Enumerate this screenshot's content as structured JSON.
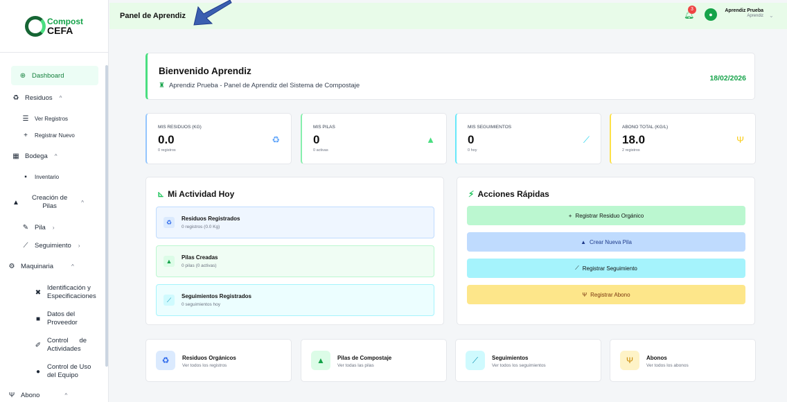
{
  "brand": {
    "line1": "Compost",
    "line2": "CEFA"
  },
  "sidebar": {
    "items": [
      {
        "label": "Dashboard",
        "icon": "globe-icon"
      },
      {
        "label": "Residuos",
        "icon": "recycle-icon"
      },
      {
        "label": "Ver Registros",
        "icon": "list-icon"
      },
      {
        "label": "Registrar Nuevo",
        "icon": "plus-icon"
      },
      {
        "label": "Bodega",
        "icon": "warehouse-icon"
      },
      {
        "label": "Inventario",
        "icon": "boxes-icon"
      },
      {
        "label": "Creación de",
        "label2": "Pilas",
        "icon": "mountain-icon"
      },
      {
        "label": "Pila",
        "icon": "leaf-icon"
      },
      {
        "label": "Seguimiento",
        "icon": "chart-line-icon"
      },
      {
        "label": "Maquinaria",
        "icon": "cogs-icon"
      },
      {
        "label": "Identificación y",
        "label2": "Especificaciones",
        "icon": "tools-icon"
      },
      {
        "label": "Datos del",
        "label2": "Proveedor",
        "icon": "truck-icon"
      },
      {
        "label": "Control      de",
        "label2": "Actividades",
        "icon": "wrench-icon"
      },
      {
        "label": "Control de Uso",
        "label2": "del Equipo",
        "icon": "clock-icon"
      },
      {
        "label": "Abono",
        "icon": "seedling-icon"
      }
    ]
  },
  "header": {
    "title": "Panel de Aprendiz",
    "notifications": "3",
    "user_name": "Aprendiz Prueba",
    "user_role": "Aprendiz"
  },
  "welcome": {
    "title": "Bienvenido Aprendiz",
    "subtitle": "Aprendiz Prueba - Panel de Aprendiz del Sistema de Compostaje",
    "date": "18/02/2026"
  },
  "stats": [
    {
      "label": "MIS RESIDUOS (KG)",
      "value": "0.0",
      "sub": "0 registros",
      "icon": "recycle-icon",
      "color": "#60a5fa"
    },
    {
      "label": "MIS PILAS",
      "value": "0",
      "sub": "0 activas",
      "icon": "mountain-icon",
      "color": "#4ade80"
    },
    {
      "label": "MIS SEGUIMIENTOS",
      "value": "0",
      "sub": "0 hoy",
      "icon": "chart-line-icon",
      "color": "#22d3ee"
    },
    {
      "label": "ABONO TOTAL (KG/L)",
      "value": "18.0",
      "sub": "2 registros",
      "icon": "seedling-icon",
      "color": "#facc15"
    }
  ],
  "activity": {
    "title": "Mi Actividad Hoy",
    "items": [
      {
        "title": "Residuos Registrados",
        "sub": "0 registros (0.0 Kg)"
      },
      {
        "title": "Pilas Creadas",
        "sub": "0 pilas (0 activas)"
      },
      {
        "title": "Seguimientos Registrados",
        "sub": "0 seguimientos hoy"
      }
    ]
  },
  "quick": {
    "title": "Acciones Rápidas",
    "buttons": [
      {
        "label": "Registrar Residuo Orgánico",
        "color": "#bbf7d0"
      },
      {
        "label": "Crear Nueva Pila",
        "color": "#bfdbfe"
      },
      {
        "label": "Registrar Seguimiento",
        "color": "#a5f3fc"
      },
      {
        "label": "Registrar Abono",
        "color": "#fde68a"
      }
    ]
  },
  "links": [
    {
      "title": "Residuos Orgánicos",
      "sub": "Ver todos los registros"
    },
    {
      "title": "Pilas de Compostaje",
      "sub": "Ver todas las pilas"
    },
    {
      "title": "Seguimientos",
      "sub": "Ver todos los seguimientos"
    },
    {
      "title": "Abonos",
      "sub": "Ver todos los abonos"
    }
  ]
}
